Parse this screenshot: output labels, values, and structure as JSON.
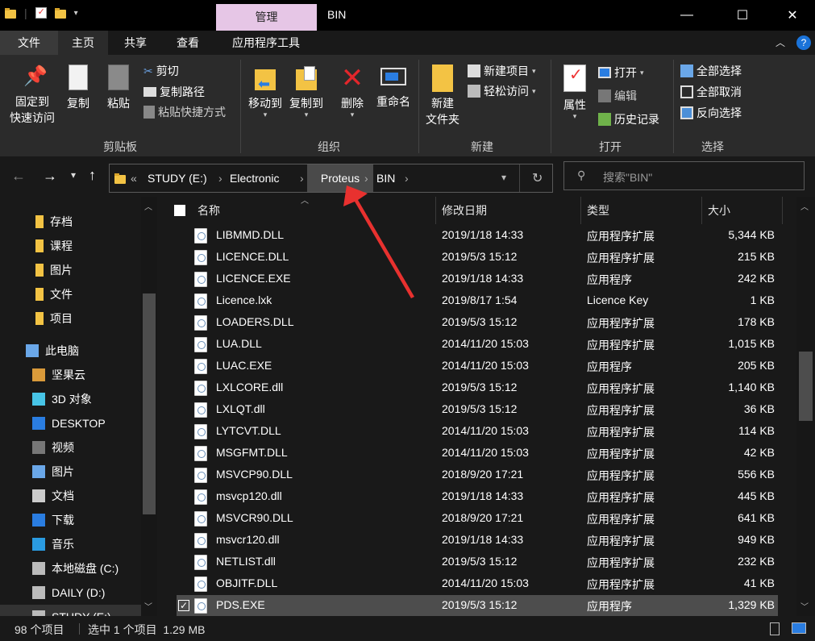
{
  "window": {
    "title": "BIN",
    "manage_tab": "管理",
    "minimize": "—",
    "maximize": "☐",
    "close": "✕"
  },
  "tabs": [
    "文件",
    "主页",
    "共享",
    "查看",
    "应用程序工具"
  ],
  "ribbon": {
    "clipboard": {
      "pin_line1": "固定到",
      "pin_line2": "快速访问",
      "copy": "复制",
      "paste": "粘贴",
      "cut": "剪切",
      "copy_path": "复制路径",
      "paste_shortcut": "粘贴快捷方式",
      "label": "剪贴板"
    },
    "organize": {
      "move_to": "移动到",
      "copy_to": "复制到",
      "delete": "删除",
      "rename": "重命名",
      "label": "组织"
    },
    "new": {
      "new_folder_line1": "新建",
      "new_folder_line2": "文件夹",
      "new_item": "新建项目",
      "easy_access": "轻松访问",
      "label": "新建"
    },
    "open": {
      "properties": "属性",
      "open": "打开",
      "edit": "编辑",
      "history": "历史记录",
      "label": "打开"
    },
    "select": {
      "select_all": "全部选择",
      "select_none": "全部取消",
      "invert": "反向选择",
      "label": "选择"
    }
  },
  "address": {
    "overflow": "«",
    "crumbs": [
      "STUDY (E:)",
      "Electronic",
      "Proteus",
      "BIN"
    ],
    "search_placeholder": "搜索\"BIN\""
  },
  "sidebar": {
    "items": [
      {
        "label": "存档",
        "icon": "folder-icon"
      },
      {
        "label": "课程",
        "icon": "folder-icon"
      },
      {
        "label": "图片",
        "icon": "folder-icon"
      },
      {
        "label": "文件",
        "icon": "folder-icon"
      },
      {
        "label": "项目",
        "icon": "folder-icon"
      },
      {
        "label": "此电脑",
        "icon": "computer-icon"
      },
      {
        "label": "坚果云",
        "icon": "nutstore-icon"
      },
      {
        "label": "3D 对象",
        "icon": "3d-objects-icon"
      },
      {
        "label": "DESKTOP",
        "icon": "desktop-icon"
      },
      {
        "label": "视频",
        "icon": "video-icon"
      },
      {
        "label": "图片",
        "icon": "pictures-icon"
      },
      {
        "label": "文档",
        "icon": "documents-icon"
      },
      {
        "label": "下载",
        "icon": "download-icon"
      },
      {
        "label": "音乐",
        "icon": "music-icon"
      },
      {
        "label": "本地磁盘 (C:)",
        "icon": "drive-icon"
      },
      {
        "label": "DAILY (D:)",
        "icon": "drive-icon"
      },
      {
        "label": "STUDY (E:)",
        "icon": "drive-icon"
      }
    ]
  },
  "columns": {
    "name": "名称",
    "date": "修改日期",
    "type": "类型",
    "size": "大小"
  },
  "files": [
    {
      "name": "LIBMMD.DLL",
      "date": "2019/1/18 14:33",
      "type": "应用程序扩展",
      "size": "5,344 KB"
    },
    {
      "name": "LICENCE.DLL",
      "date": "2019/5/3 15:12",
      "type": "应用程序扩展",
      "size": "215 KB"
    },
    {
      "name": "LICENCE.EXE",
      "date": "2019/1/18 14:33",
      "type": "应用程序",
      "size": "242 KB"
    },
    {
      "name": "Licence.lxk",
      "date": "2019/8/17 1:54",
      "type": "Licence Key",
      "size": "1 KB"
    },
    {
      "name": "LOADERS.DLL",
      "date": "2019/5/3 15:12",
      "type": "应用程序扩展",
      "size": "178 KB"
    },
    {
      "name": "LUA.DLL",
      "date": "2014/11/20 15:03",
      "type": "应用程序扩展",
      "size": "1,015 KB"
    },
    {
      "name": "LUAC.EXE",
      "date": "2014/11/20 15:03",
      "type": "应用程序",
      "size": "205 KB"
    },
    {
      "name": "LXLCORE.dll",
      "date": "2019/5/3 15:12",
      "type": "应用程序扩展",
      "size": "1,140 KB"
    },
    {
      "name": "LXLQT.dll",
      "date": "2019/5/3 15:12",
      "type": "应用程序扩展",
      "size": "36 KB"
    },
    {
      "name": "LYTCVT.DLL",
      "date": "2014/11/20 15:03",
      "type": "应用程序扩展",
      "size": "114 KB"
    },
    {
      "name": "MSGFMT.DLL",
      "date": "2014/11/20 15:03",
      "type": "应用程序扩展",
      "size": "42 KB"
    },
    {
      "name": "MSVCP90.DLL",
      "date": "2018/9/20 17:21",
      "type": "应用程序扩展",
      "size": "556 KB"
    },
    {
      "name": "msvcp120.dll",
      "date": "2019/1/18 14:33",
      "type": "应用程序扩展",
      "size": "445 KB"
    },
    {
      "name": "MSVCR90.DLL",
      "date": "2018/9/20 17:21",
      "type": "应用程序扩展",
      "size": "641 KB"
    },
    {
      "name": "msvcr120.dll",
      "date": "2019/1/18 14:33",
      "type": "应用程序扩展",
      "size": "949 KB"
    },
    {
      "name": "NETLIST.dll",
      "date": "2019/5/3 15:12",
      "type": "应用程序扩展",
      "size": "232 KB"
    },
    {
      "name": "OBJITF.DLL",
      "date": "2014/11/20 15:03",
      "type": "应用程序扩展",
      "size": "41 KB"
    },
    {
      "name": "PDS.EXE",
      "date": "2019/5/3 15:12",
      "type": "应用程序",
      "size": "1,329 KB",
      "selected": true
    }
  ],
  "status": {
    "count": "98 个项目",
    "selection": "选中 1 个项目  1.29 MB"
  },
  "colors": {
    "accent_manage": "#e6c6e6",
    "annotation_arrow": "#e8312f",
    "selected_row": "#4d4d4d"
  }
}
